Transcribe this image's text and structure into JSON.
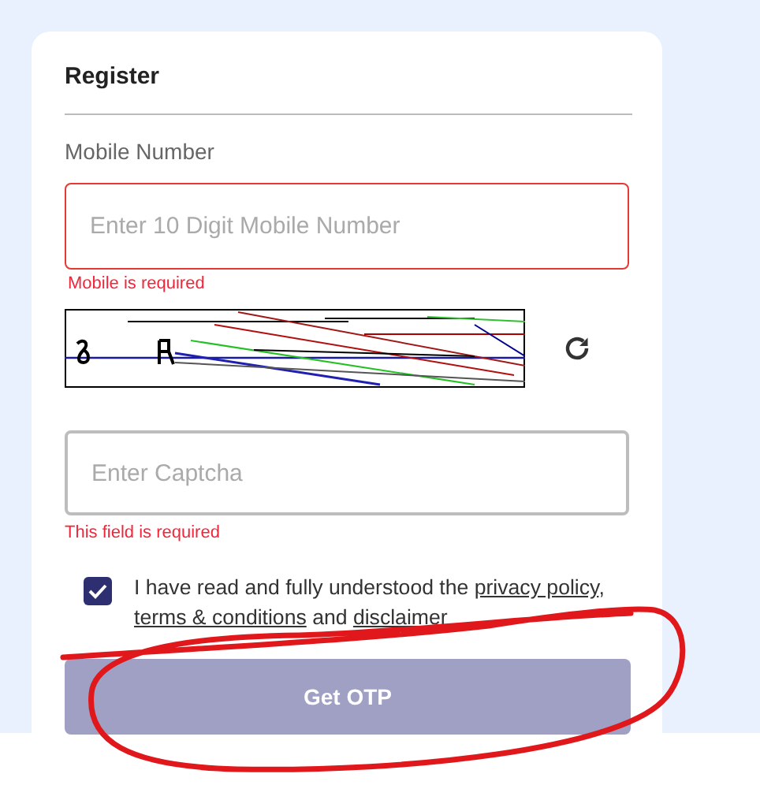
{
  "card": {
    "title": "Register"
  },
  "mobile": {
    "label": "Mobile Number",
    "placeholder": "Enter 10 Digit Mobile Number",
    "invalid": true,
    "error": "Mobile is required"
  },
  "captcha_input": {
    "placeholder": "Enter Captcha",
    "invalid": false,
    "error": "This field is required"
  },
  "consent": {
    "checked": true,
    "parts": [
      {
        "kind": "text",
        "text": "I have read and fully understood the "
      },
      {
        "kind": "link",
        "text": "privacy policy"
      },
      {
        "kind": "text",
        "text": ", "
      },
      {
        "kind": "link",
        "text": "terms & conditions"
      },
      {
        "kind": "text",
        "text": " and "
      },
      {
        "kind": "link",
        "text": "disclaimer"
      }
    ]
  },
  "submit": {
    "label": "Get OTP",
    "disabled": true
  },
  "annotation": {
    "kind": "freehand-circle"
  }
}
